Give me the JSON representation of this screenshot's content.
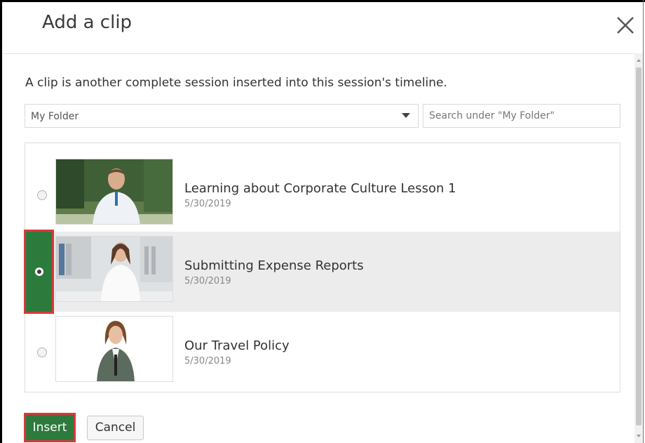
{
  "dialog": {
    "title": "Add a clip",
    "description": "A clip is another complete session inserted into this session's timeline.",
    "close_icon": "close-icon"
  },
  "folder": {
    "selected": "My Folder",
    "search_placeholder": "Search under \"My Folder\""
  },
  "clips": [
    {
      "title": "Learning about Corporate Culture Lesson 1",
      "date": "5/30/2019",
      "selected": false
    },
    {
      "title": "Submitting Expense Reports",
      "date": "5/30/2019",
      "selected": true
    },
    {
      "title": "Our Travel Policy",
      "date": "5/30/2019",
      "selected": false
    }
  ],
  "actions": {
    "insert_label": "Insert",
    "cancel_label": "Cancel"
  },
  "colors": {
    "accent_green": "#2c7a3c",
    "highlight_red": "#d63a3a",
    "selected_row_bg": "#ececec"
  }
}
